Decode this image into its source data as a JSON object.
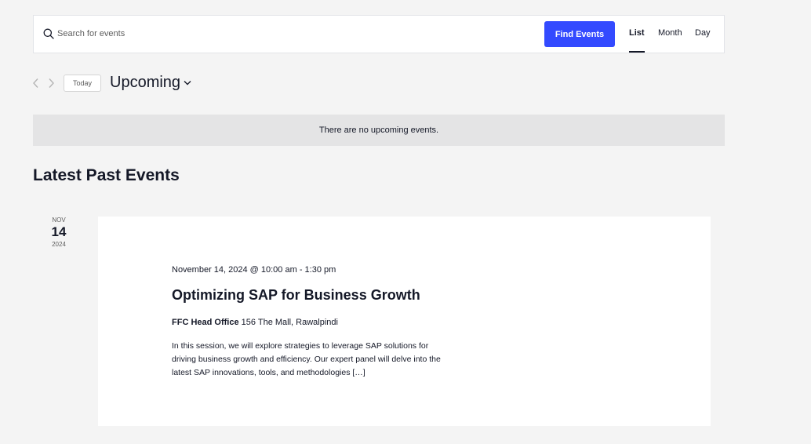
{
  "search": {
    "placeholder": "Search for events",
    "value": "",
    "button_label": "Find Events"
  },
  "views": {
    "list": "List",
    "month": "Month",
    "day": "Day",
    "active": "List"
  },
  "nav": {
    "today_label": "Today",
    "period_label": "Upcoming"
  },
  "notice": "There are no upcoming events.",
  "past_events": {
    "heading": "Latest Past Events",
    "events": [
      {
        "month": "NOV",
        "day": "14",
        "year": "2024",
        "datetime": "November 14, 2024 @ 10:00 am - 1:30 pm",
        "title": "Optimizing SAP for Business Growth",
        "venue_name": "FFC Head Office",
        "venue_address": "156 The Mall, Rawalpindi",
        "description": "In this session, we will explore strategies to leverage SAP solutions for driving business growth and efficiency. Our expert panel will delve into the latest SAP innovations, tools, and methodologies […]"
      }
    ]
  },
  "colors": {
    "accent": "#334aff",
    "text": "#141827",
    "background": "#f4f4f4",
    "notice_bg": "#e4e4e5"
  },
  "icons": {
    "search": "search-icon",
    "prev": "chevron-left-icon",
    "next": "chevron-right-icon",
    "dropdown": "chevron-down-icon"
  }
}
